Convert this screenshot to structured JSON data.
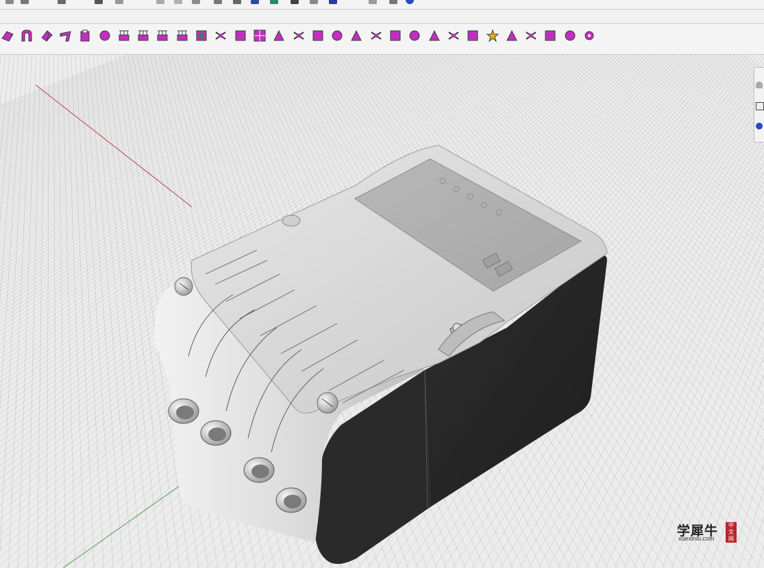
{
  "colors": {
    "icon_primary": "#c22ec2",
    "icon_dark": "#3a3a3a",
    "grid_line": "#9a9a9a",
    "axis_x": "#b84040",
    "axis_y": "#4a9a4a",
    "model_light": "#d6d6d6",
    "model_dark": "#262626",
    "watermark_seal": "#b8262b"
  },
  "toolbar": {
    "icons": [
      "surface-from-curves-icon",
      "arch-icon",
      "extrude-icon",
      "sweep-icon",
      "loft-icon",
      "blend-surface-icon",
      "array-icon",
      "array-icon",
      "array-icon",
      "array-icon",
      "check-box-icon",
      "split-icon",
      "grid-delete-icon",
      "grid-icon",
      "trim-icon",
      "offset-icon",
      "offset-icon",
      "rotate-icon",
      "extend-icon",
      "fillet-icon",
      "patch-icon",
      "explode-icon",
      "solid-icon",
      "intersect-icon",
      "branch-icon",
      "star-icon",
      "target-icon",
      "flow-icon",
      "bend-icon",
      "twist-icon",
      "gear-icon"
    ]
  },
  "right_panel": {
    "icons": [
      "lamp-icon",
      "lock-icon",
      "magnet-icon"
    ]
  },
  "watermark": {
    "title": "学犀牛",
    "url": "xuexiniu.com",
    "seal": [
      "中",
      "文",
      "网"
    ]
  }
}
